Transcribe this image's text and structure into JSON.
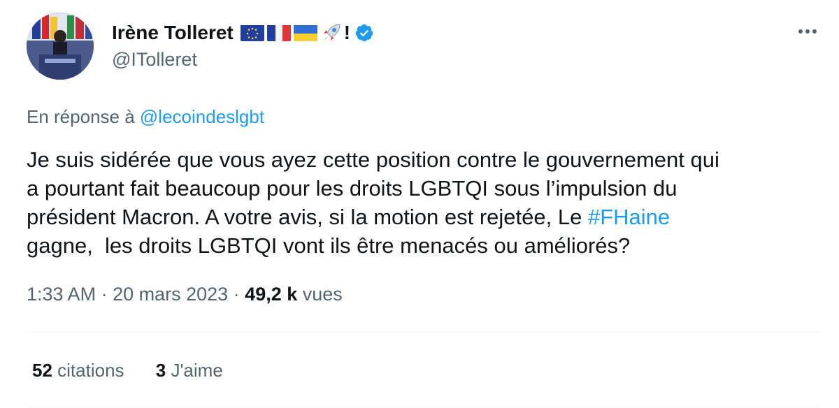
{
  "author": {
    "name": "Irène Tolleret",
    "name_suffix": "!",
    "handle": "@ITolleret",
    "verified": true,
    "name_emojis": [
      "eu-flag",
      "france-flag",
      "ukraine-flag",
      "rocket"
    ]
  },
  "reply": {
    "prefix": "En réponse à",
    "mention": "@lecoindeslgbt"
  },
  "body": {
    "line1": "Je suis sidérée que vous ayez cette position contre le gouvernement qui",
    "line2": "a pourtant fait beaucoup pour les droits LGBTQI sous l’impulsion du",
    "line3_prefix": "président Macron. A votre avis, si la motion est rejetée, Le ",
    "hashtag": "#FHaine",
    "line4": "gagne,  les droits LGBTQI vont ils être menacés ou améliorés?"
  },
  "meta": {
    "time": "1:33 AM",
    "sep1": " · ",
    "date": "20 mars 2023",
    "sep2": " · ",
    "views_count": "49,2 k",
    "views_label": " vues"
  },
  "stats": {
    "quotes_count": "52",
    "quotes_label": " citations",
    "likes_count": "3",
    "likes_label": " J'aime"
  },
  "colors": {
    "link": "#1d9bf0",
    "secondary": "#536471",
    "primary": "#0f1419"
  }
}
